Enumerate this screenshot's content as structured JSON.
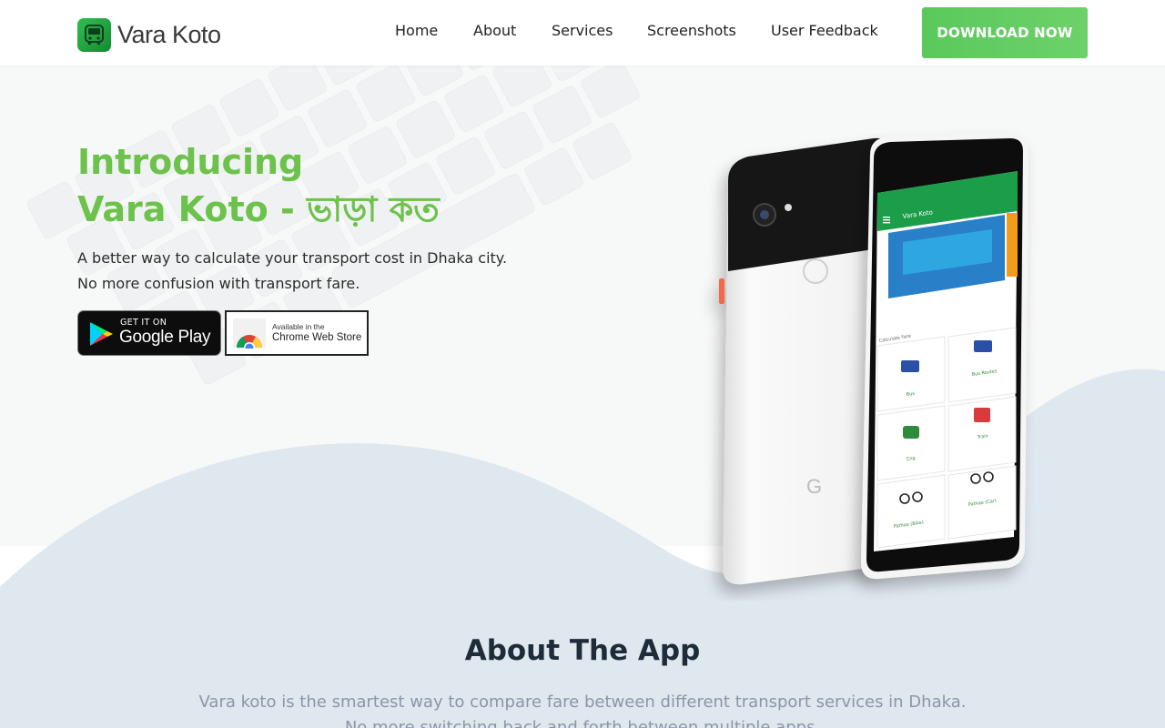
{
  "brand": {
    "name": "Vara Koto"
  },
  "nav": {
    "items": [
      {
        "label": "Home"
      },
      {
        "label": "About"
      },
      {
        "label": "Services"
      },
      {
        "label": "Screenshots"
      },
      {
        "label": "User Feedback"
      }
    ],
    "download_label": "DOWNLOAD NOW"
  },
  "hero": {
    "title_line1": "Introducing",
    "title_line2": "Vara Koto - ভাড়া কত",
    "subtitle_line1": "A better way to calculate your transport cost in Dhaka city.",
    "subtitle_line2": "No more confusion with transport fare.",
    "google_play": {
      "small": "GET IT ON",
      "big": "Google Play"
    },
    "chrome_store": {
      "small": "Available in the",
      "big": "Chrome Web Store"
    }
  },
  "phone_app": {
    "app_title": "Vara Koto",
    "section_label": "Calculate Fare",
    "tiles": [
      "Bus",
      "Bus Routes",
      "Cng",
      "Train",
      "Pathao (Bike)",
      "Pathao (Car)"
    ]
  },
  "about": {
    "title": "About The App",
    "text_line1": "Vara koto is the smartest way to compare fare between different transport services in Dhaka.",
    "text_line2": "No more switching back and forth between multiple apps."
  },
  "colors": {
    "accent": "#6cc24a",
    "download_button": "#5ac95c",
    "wave": "#dfe7ef",
    "heading_dark": "#1e2b38",
    "muted_text": "#8a97a6",
    "app_bar": "#1f9d4a"
  },
  "icons": [
    "bus-logo-icon",
    "google-play-icon",
    "chrome-icon",
    "bus-icon",
    "cng-icon",
    "train-icon",
    "bike-icon",
    "menu-icon"
  ]
}
